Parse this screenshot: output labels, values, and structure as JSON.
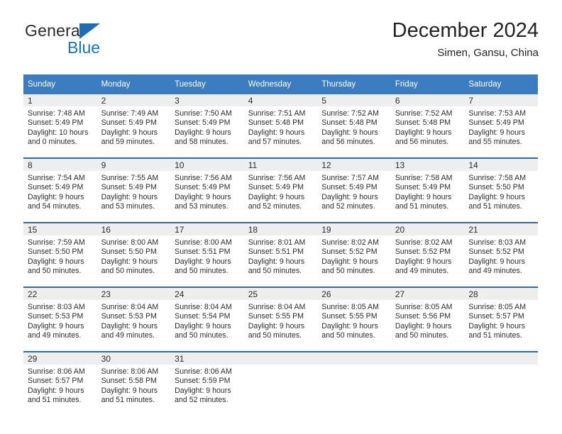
{
  "brand": {
    "name_part1": "General",
    "name_part2": "Blue",
    "triangle_icon": "triangle-icon",
    "accent_color": "#1277c4"
  },
  "header": {
    "title": "December 2024",
    "subtitle": "Simen, Gansu, China"
  },
  "calendar": {
    "header_bg": "#3b7dc0",
    "daynum_bg": "#eeeeee",
    "row_divider_color": "#2e6da4",
    "weekday_headers": [
      "Sunday",
      "Monday",
      "Tuesday",
      "Wednesday",
      "Thursday",
      "Friday",
      "Saturday"
    ],
    "weeks": [
      [
        {
          "day": "1",
          "sunrise": "Sunrise: 7:48 AM",
          "sunset": "Sunset: 5:49 PM",
          "daylight_line1": "Daylight: 10 hours",
          "daylight_line2": "and 0 minutes."
        },
        {
          "day": "2",
          "sunrise": "Sunrise: 7:49 AM",
          "sunset": "Sunset: 5:49 PM",
          "daylight_line1": "Daylight: 9 hours",
          "daylight_line2": "and 59 minutes."
        },
        {
          "day": "3",
          "sunrise": "Sunrise: 7:50 AM",
          "sunset": "Sunset: 5:49 PM",
          "daylight_line1": "Daylight: 9 hours",
          "daylight_line2": "and 58 minutes."
        },
        {
          "day": "4",
          "sunrise": "Sunrise: 7:51 AM",
          "sunset": "Sunset: 5:48 PM",
          "daylight_line1": "Daylight: 9 hours",
          "daylight_line2": "and 57 minutes."
        },
        {
          "day": "5",
          "sunrise": "Sunrise: 7:52 AM",
          "sunset": "Sunset: 5:48 PM",
          "daylight_line1": "Daylight: 9 hours",
          "daylight_line2": "and 56 minutes."
        },
        {
          "day": "6",
          "sunrise": "Sunrise: 7:52 AM",
          "sunset": "Sunset: 5:48 PM",
          "daylight_line1": "Daylight: 9 hours",
          "daylight_line2": "and 56 minutes."
        },
        {
          "day": "7",
          "sunrise": "Sunrise: 7:53 AM",
          "sunset": "Sunset: 5:49 PM",
          "daylight_line1": "Daylight: 9 hours",
          "daylight_line2": "and 55 minutes."
        }
      ],
      [
        {
          "day": "8",
          "sunrise": "Sunrise: 7:54 AM",
          "sunset": "Sunset: 5:49 PM",
          "daylight_line1": "Daylight: 9 hours",
          "daylight_line2": "and 54 minutes."
        },
        {
          "day": "9",
          "sunrise": "Sunrise: 7:55 AM",
          "sunset": "Sunset: 5:49 PM",
          "daylight_line1": "Daylight: 9 hours",
          "daylight_line2": "and 53 minutes."
        },
        {
          "day": "10",
          "sunrise": "Sunrise: 7:56 AM",
          "sunset": "Sunset: 5:49 PM",
          "daylight_line1": "Daylight: 9 hours",
          "daylight_line2": "and 53 minutes."
        },
        {
          "day": "11",
          "sunrise": "Sunrise: 7:56 AM",
          "sunset": "Sunset: 5:49 PM",
          "daylight_line1": "Daylight: 9 hours",
          "daylight_line2": "and 52 minutes."
        },
        {
          "day": "12",
          "sunrise": "Sunrise: 7:57 AM",
          "sunset": "Sunset: 5:49 PM",
          "daylight_line1": "Daylight: 9 hours",
          "daylight_line2": "and 52 minutes."
        },
        {
          "day": "13",
          "sunrise": "Sunrise: 7:58 AM",
          "sunset": "Sunset: 5:49 PM",
          "daylight_line1": "Daylight: 9 hours",
          "daylight_line2": "and 51 minutes."
        },
        {
          "day": "14",
          "sunrise": "Sunrise: 7:58 AM",
          "sunset": "Sunset: 5:50 PM",
          "daylight_line1": "Daylight: 9 hours",
          "daylight_line2": "and 51 minutes."
        }
      ],
      [
        {
          "day": "15",
          "sunrise": "Sunrise: 7:59 AM",
          "sunset": "Sunset: 5:50 PM",
          "daylight_line1": "Daylight: 9 hours",
          "daylight_line2": "and 50 minutes."
        },
        {
          "day": "16",
          "sunrise": "Sunrise: 8:00 AM",
          "sunset": "Sunset: 5:50 PM",
          "daylight_line1": "Daylight: 9 hours",
          "daylight_line2": "and 50 minutes."
        },
        {
          "day": "17",
          "sunrise": "Sunrise: 8:00 AM",
          "sunset": "Sunset: 5:51 PM",
          "daylight_line1": "Daylight: 9 hours",
          "daylight_line2": "and 50 minutes."
        },
        {
          "day": "18",
          "sunrise": "Sunrise: 8:01 AM",
          "sunset": "Sunset: 5:51 PM",
          "daylight_line1": "Daylight: 9 hours",
          "daylight_line2": "and 50 minutes."
        },
        {
          "day": "19",
          "sunrise": "Sunrise: 8:02 AM",
          "sunset": "Sunset: 5:52 PM",
          "daylight_line1": "Daylight: 9 hours",
          "daylight_line2": "and 50 minutes."
        },
        {
          "day": "20",
          "sunrise": "Sunrise: 8:02 AM",
          "sunset": "Sunset: 5:52 PM",
          "daylight_line1": "Daylight: 9 hours",
          "daylight_line2": "and 49 minutes."
        },
        {
          "day": "21",
          "sunrise": "Sunrise: 8:03 AM",
          "sunset": "Sunset: 5:52 PM",
          "daylight_line1": "Daylight: 9 hours",
          "daylight_line2": "and 49 minutes."
        }
      ],
      [
        {
          "day": "22",
          "sunrise": "Sunrise: 8:03 AM",
          "sunset": "Sunset: 5:53 PM",
          "daylight_line1": "Daylight: 9 hours",
          "daylight_line2": "and 49 minutes."
        },
        {
          "day": "23",
          "sunrise": "Sunrise: 8:04 AM",
          "sunset": "Sunset: 5:53 PM",
          "daylight_line1": "Daylight: 9 hours",
          "daylight_line2": "and 49 minutes."
        },
        {
          "day": "24",
          "sunrise": "Sunrise: 8:04 AM",
          "sunset": "Sunset: 5:54 PM",
          "daylight_line1": "Daylight: 9 hours",
          "daylight_line2": "and 50 minutes."
        },
        {
          "day": "25",
          "sunrise": "Sunrise: 8:04 AM",
          "sunset": "Sunset: 5:55 PM",
          "daylight_line1": "Daylight: 9 hours",
          "daylight_line2": "and 50 minutes."
        },
        {
          "day": "26",
          "sunrise": "Sunrise: 8:05 AM",
          "sunset": "Sunset: 5:55 PM",
          "daylight_line1": "Daylight: 9 hours",
          "daylight_line2": "and 50 minutes."
        },
        {
          "day": "27",
          "sunrise": "Sunrise: 8:05 AM",
          "sunset": "Sunset: 5:56 PM",
          "daylight_line1": "Daylight: 9 hours",
          "daylight_line2": "and 50 minutes."
        },
        {
          "day": "28",
          "sunrise": "Sunrise: 8:05 AM",
          "sunset": "Sunset: 5:57 PM",
          "daylight_line1": "Daylight: 9 hours",
          "daylight_line2": "and 51 minutes."
        }
      ],
      [
        {
          "day": "29",
          "sunrise": "Sunrise: 8:06 AM",
          "sunset": "Sunset: 5:57 PM",
          "daylight_line1": "Daylight: 9 hours",
          "daylight_line2": "and 51 minutes."
        },
        {
          "day": "30",
          "sunrise": "Sunrise: 8:06 AM",
          "sunset": "Sunset: 5:58 PM",
          "daylight_line1": "Daylight: 9 hours",
          "daylight_line2": "and 51 minutes."
        },
        {
          "day": "31",
          "sunrise": "Sunrise: 8:06 AM",
          "sunset": "Sunset: 5:59 PM",
          "daylight_line1": "Daylight: 9 hours",
          "daylight_line2": "and 52 minutes."
        },
        {
          "day": "",
          "sunrise": "",
          "sunset": "",
          "daylight_line1": "",
          "daylight_line2": ""
        },
        {
          "day": "",
          "sunrise": "",
          "sunset": "",
          "daylight_line1": "",
          "daylight_line2": ""
        },
        {
          "day": "",
          "sunrise": "",
          "sunset": "",
          "daylight_line1": "",
          "daylight_line2": ""
        },
        {
          "day": "",
          "sunrise": "",
          "sunset": "",
          "daylight_line1": "",
          "daylight_line2": ""
        }
      ]
    ]
  }
}
